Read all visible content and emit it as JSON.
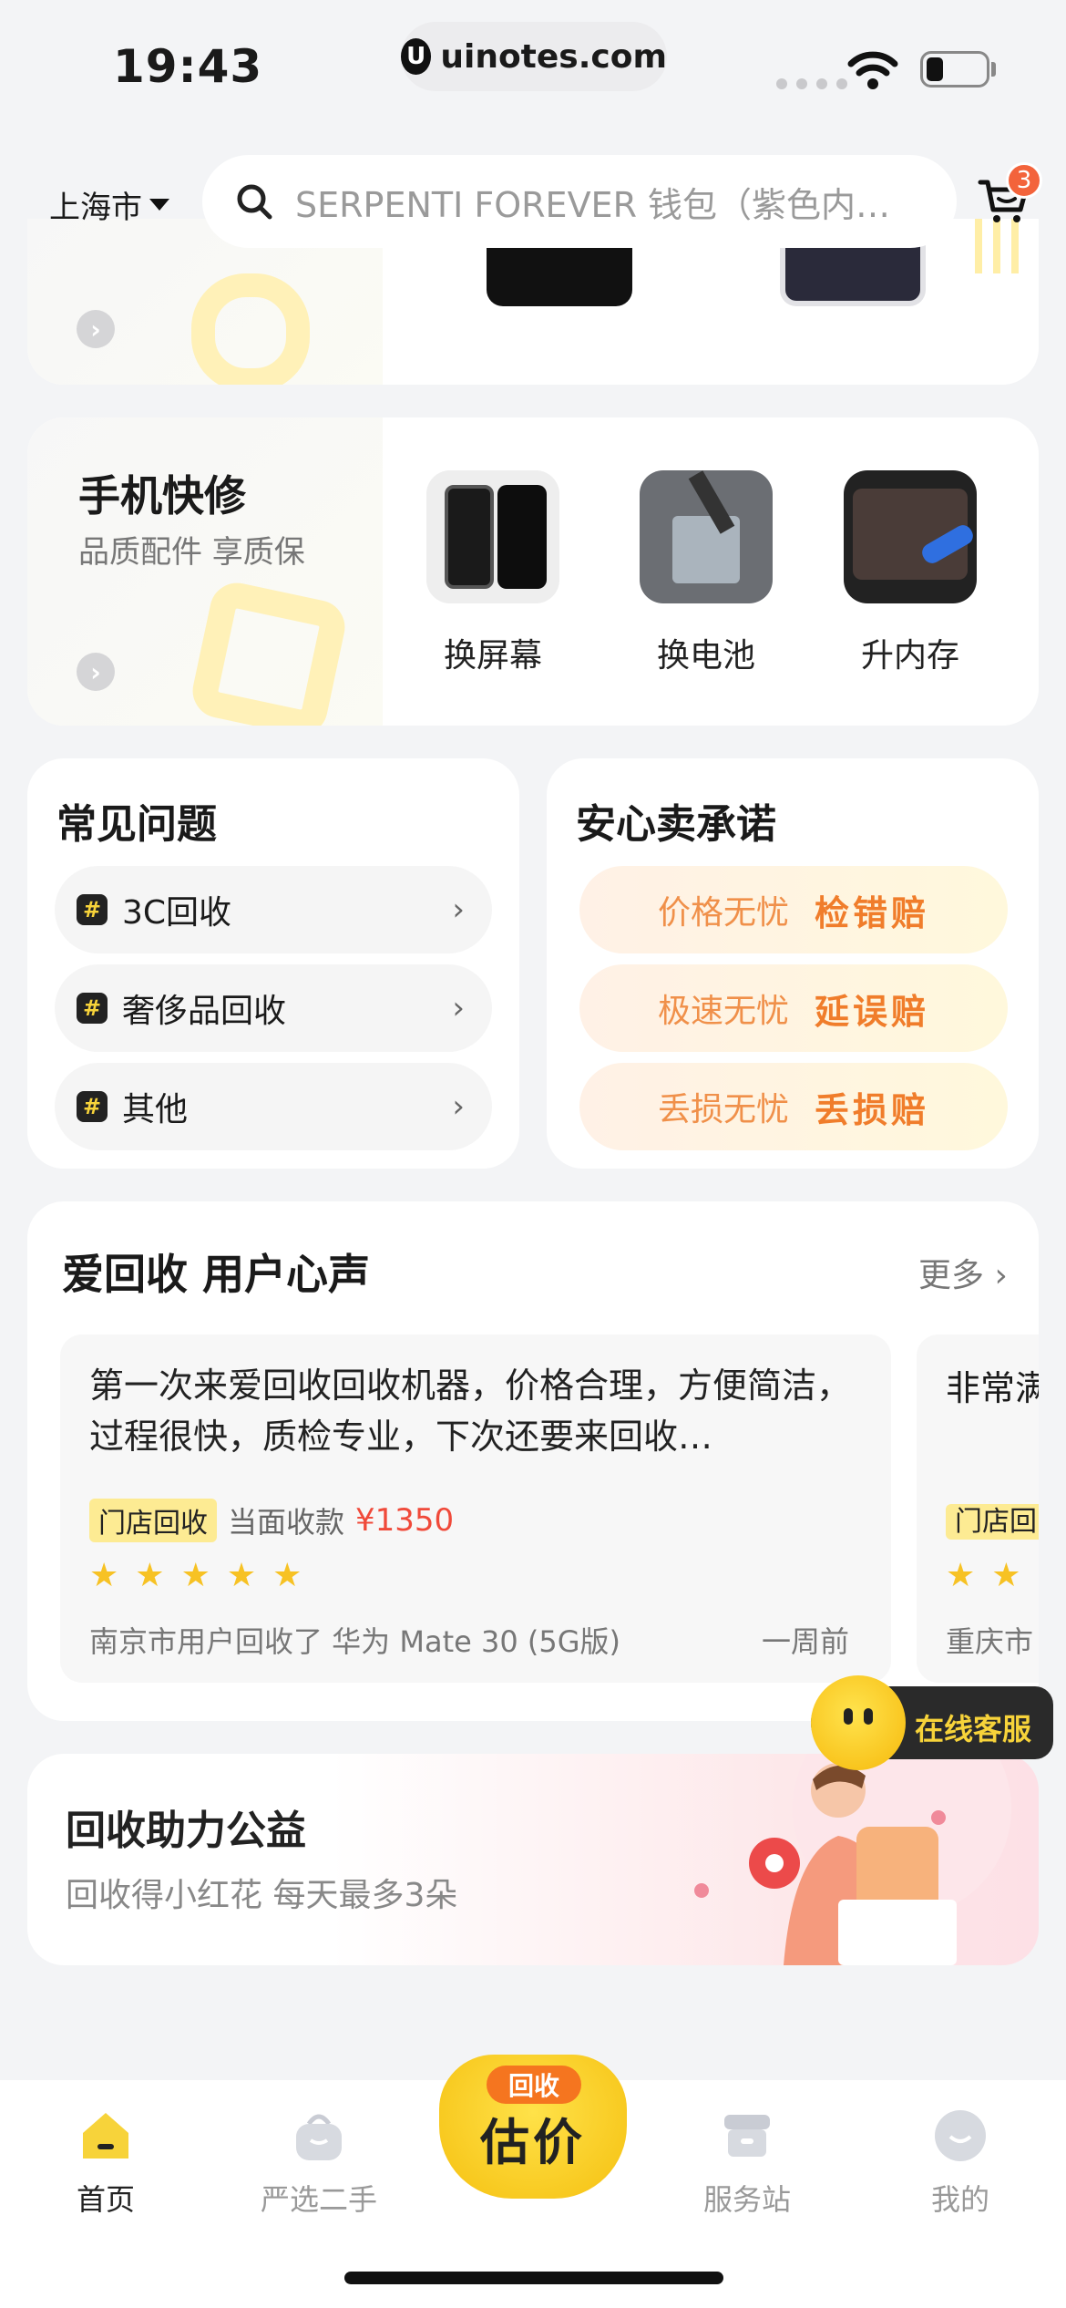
{
  "status_bar": {
    "time": "19:43",
    "url": "uinotes.com"
  },
  "header": {
    "city": "上海市",
    "search_placeholder": "SERPENTI FOREVER 钱包（紫色内…",
    "cart_count": "3"
  },
  "repair": {
    "title": "手机快修",
    "subtitle": "品质配件 享质保",
    "items": [
      {
        "label": "换屏幕"
      },
      {
        "label": "换电池"
      },
      {
        "label": "升内存"
      }
    ]
  },
  "faq": {
    "title": "常见问题",
    "items": [
      {
        "label": "3C回收"
      },
      {
        "label": "奢侈品回收"
      },
      {
        "label": "其他"
      }
    ]
  },
  "promise": {
    "title": "安心卖承诺",
    "items": [
      {
        "text": "价格无忧",
        "highlight": "检错赔"
      },
      {
        "text": "极速无忧",
        "highlight": "延误赔"
      },
      {
        "text": "丢损无忧",
        "highlight": "丢损赔"
      }
    ]
  },
  "reviews": {
    "title": "爱回收 用户心声",
    "more": "更多",
    "items": [
      {
        "text": "第一次来爱回收回收机器，价格合理，方便简洁，过程很快，质检专业，下次还要来回收…",
        "tag": "门店回收",
        "pay_label": "当面收款",
        "price": "¥1350",
        "rating": 5,
        "footer": "南京市用户回收了 华为 Mate 30 (5G版)",
        "when": "一周前"
      },
      {
        "text": "非常满",
        "tag": "门店回",
        "footer": "重庆市"
      }
    ]
  },
  "online_service": {
    "label": "在线客服"
  },
  "charity": {
    "title": "回收助力公益",
    "subtitle": "回收得小红花 每天最多3朵"
  },
  "bottom_nav": {
    "items": [
      {
        "label": "首页",
        "active": true
      },
      {
        "label": "严选二手"
      },
      {
        "label": "服务站"
      },
      {
        "label": "我的"
      }
    ],
    "center": {
      "top": "回收",
      "main": "估价"
    }
  },
  "colors": {
    "accent_yellow": "#f7d33a",
    "accent_orange": "#f07d2b",
    "price_red": "#f04a3a",
    "background": "#f3f4f6"
  }
}
